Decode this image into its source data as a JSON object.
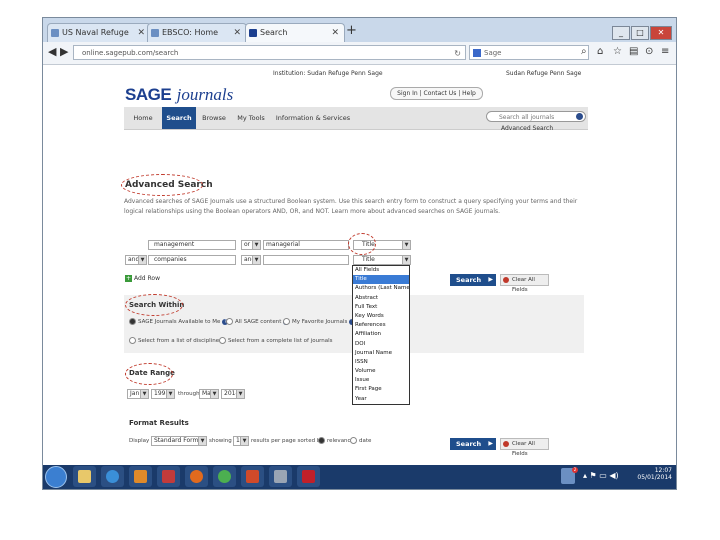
{
  "browser": {
    "tabs": [
      {
        "label": "US Naval Refuge"
      },
      {
        "label": "EBSCO: Home"
      },
      {
        "label": "Search"
      }
    ],
    "new_tab": "+",
    "url": "online.sagepub.com/search",
    "search_placeholder": "Sage",
    "window_buttons": [
      "_",
      "□",
      "✕"
    ]
  },
  "site": {
    "top_links": {
      "institution": "Institution: Sudan Refuge Penn Sage",
      "user": "Sudan Refuge Penn Sage"
    },
    "logo_sage": "SAGE",
    "logo_journals": "journals",
    "account_links": "Sign In | Contact Us | Help",
    "site_search_placeholder": "Search all journals",
    "advanced_search_link": "Advanced Search",
    "nav": [
      {
        "label": "Home"
      },
      {
        "label": "Search"
      },
      {
        "label": "Browse"
      },
      {
        "label": "My Tools"
      },
      {
        "label": "Information & Services"
      }
    ]
  },
  "advanced_search": {
    "heading": "Advanced Search",
    "description": "Advanced searches of SAGE Journals use a structured Boolean system. Use this search entry form to construct a query specifying your terms and their logical relationships using the Boolean operators AND, OR, and NOT. Learn more about advanced searches on SAGE journals.",
    "rows": [
      {
        "operator": "",
        "term": "management",
        "bool": "or",
        "term2": "managerial",
        "field": "Title"
      },
      {
        "operator": "and",
        "term": "companies",
        "bool": "and",
        "term2": "",
        "field": "Title"
      }
    ],
    "add_row": "Add Row",
    "search_button": "Search",
    "clear_button": "Clear All Fields"
  },
  "field_dropdown": {
    "options": [
      "All Fields",
      "Title",
      "Authors (Last Name)",
      "Abstract",
      "Full Text",
      "Key Words",
      "References",
      "Affiliation",
      "DOI",
      "Journal Name",
      "ISSN",
      "Volume",
      "Issue",
      "First Page",
      "Year"
    ],
    "selected_index": 1
  },
  "search_within": {
    "heading": "Search Within",
    "options": [
      {
        "label": "SAGE Journals Available to Me",
        "selected": true
      },
      {
        "label": "All SAGE content",
        "selected": false
      },
      {
        "label": "My Favorite Journals",
        "selected": false
      }
    ],
    "discipline_options": [
      {
        "label": "Select from a list of disciplines"
      },
      {
        "label": "Select from a complete list of journals"
      }
    ]
  },
  "date_range": {
    "heading": "Date Range",
    "from_month": "Jan",
    "from_year": "1998",
    "through_label": "through",
    "to_month": "May",
    "to_year": "2014"
  },
  "format_results": {
    "heading": "Format Results",
    "display_label": "Display",
    "display_value": "Standard Format",
    "showing_label": "showing",
    "per_page": "10",
    "sorted_label": "results per page sorted by",
    "sort_options": [
      {
        "label": "relevance",
        "selected": true
      },
      {
        "label": "date",
        "selected": false
      }
    ]
  },
  "taskbar": {
    "time": "12:07",
    "date": "05/01/2014",
    "notification_count": "2"
  }
}
